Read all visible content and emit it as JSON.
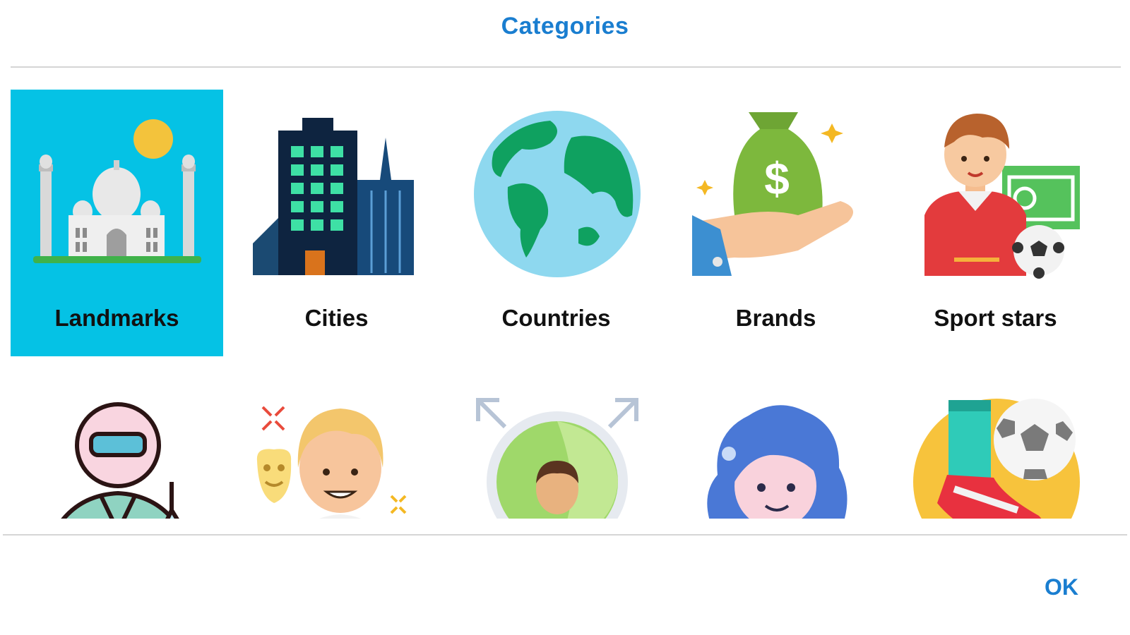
{
  "dialog": {
    "title": "Categories",
    "ok_label": "OK"
  },
  "categories": [
    {
      "label": "Landmarks",
      "icon": "taj-mahal-icon",
      "selected": true
    },
    {
      "label": "Cities",
      "icon": "city-buildings-icon",
      "selected": false
    },
    {
      "label": "Countries",
      "icon": "globe-icon",
      "selected": false
    },
    {
      "label": "Brands",
      "icon": "money-bag-hand-icon",
      "selected": false
    },
    {
      "label": "Sport stars",
      "icon": "football-player-icon",
      "selected": false
    },
    {
      "label": "",
      "icon": "scientist-icon",
      "selected": false
    },
    {
      "label": "",
      "icon": "actor-icon",
      "selected": false
    },
    {
      "label": "",
      "icon": "person-arrows-icon",
      "selected": false
    },
    {
      "label": "",
      "icon": "singer-girl-icon",
      "selected": false
    },
    {
      "label": "",
      "icon": "soccer-ball-boot-icon",
      "selected": false
    }
  ],
  "colors": {
    "accent": "#1a7ed0",
    "selected_tile": "#05c2e5",
    "divider": "#d5d5d5"
  }
}
